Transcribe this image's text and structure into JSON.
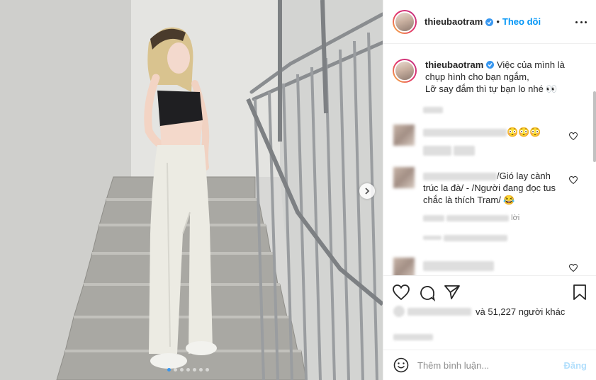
{
  "header": {
    "username": "thieubaotram",
    "separator": "•",
    "follow_label": "Theo dõi"
  },
  "caption": {
    "username": "thieubaotram",
    "line1": "Việc của mình là",
    "line2": "chụp hình cho bạn ngắm,",
    "line3": "Lỡ say đắm thì tự bạn lo nhé 👀"
  },
  "comments": [
    {
      "text_suffix": "😳😳😳"
    },
    {
      "line1": "/Gió lay cành",
      "line2": "trúc la đà/ - /Người đang đọc tus",
      "line3": "chắc là thích Tram/ 😂",
      "meta_suffix": "lời"
    },
    {
      "text_suffix": ""
    }
  ],
  "likes": {
    "text": "và 51,227 người khác"
  },
  "add_comment": {
    "placeholder": "Thêm bình luận...",
    "post_label": "Đăng"
  },
  "carousel": {
    "slide_count": 7,
    "active_index": 0
  },
  "colors": {
    "accent": "#0095f6",
    "verified": "#3897f0",
    "post_disabled": "#b2dffc"
  }
}
